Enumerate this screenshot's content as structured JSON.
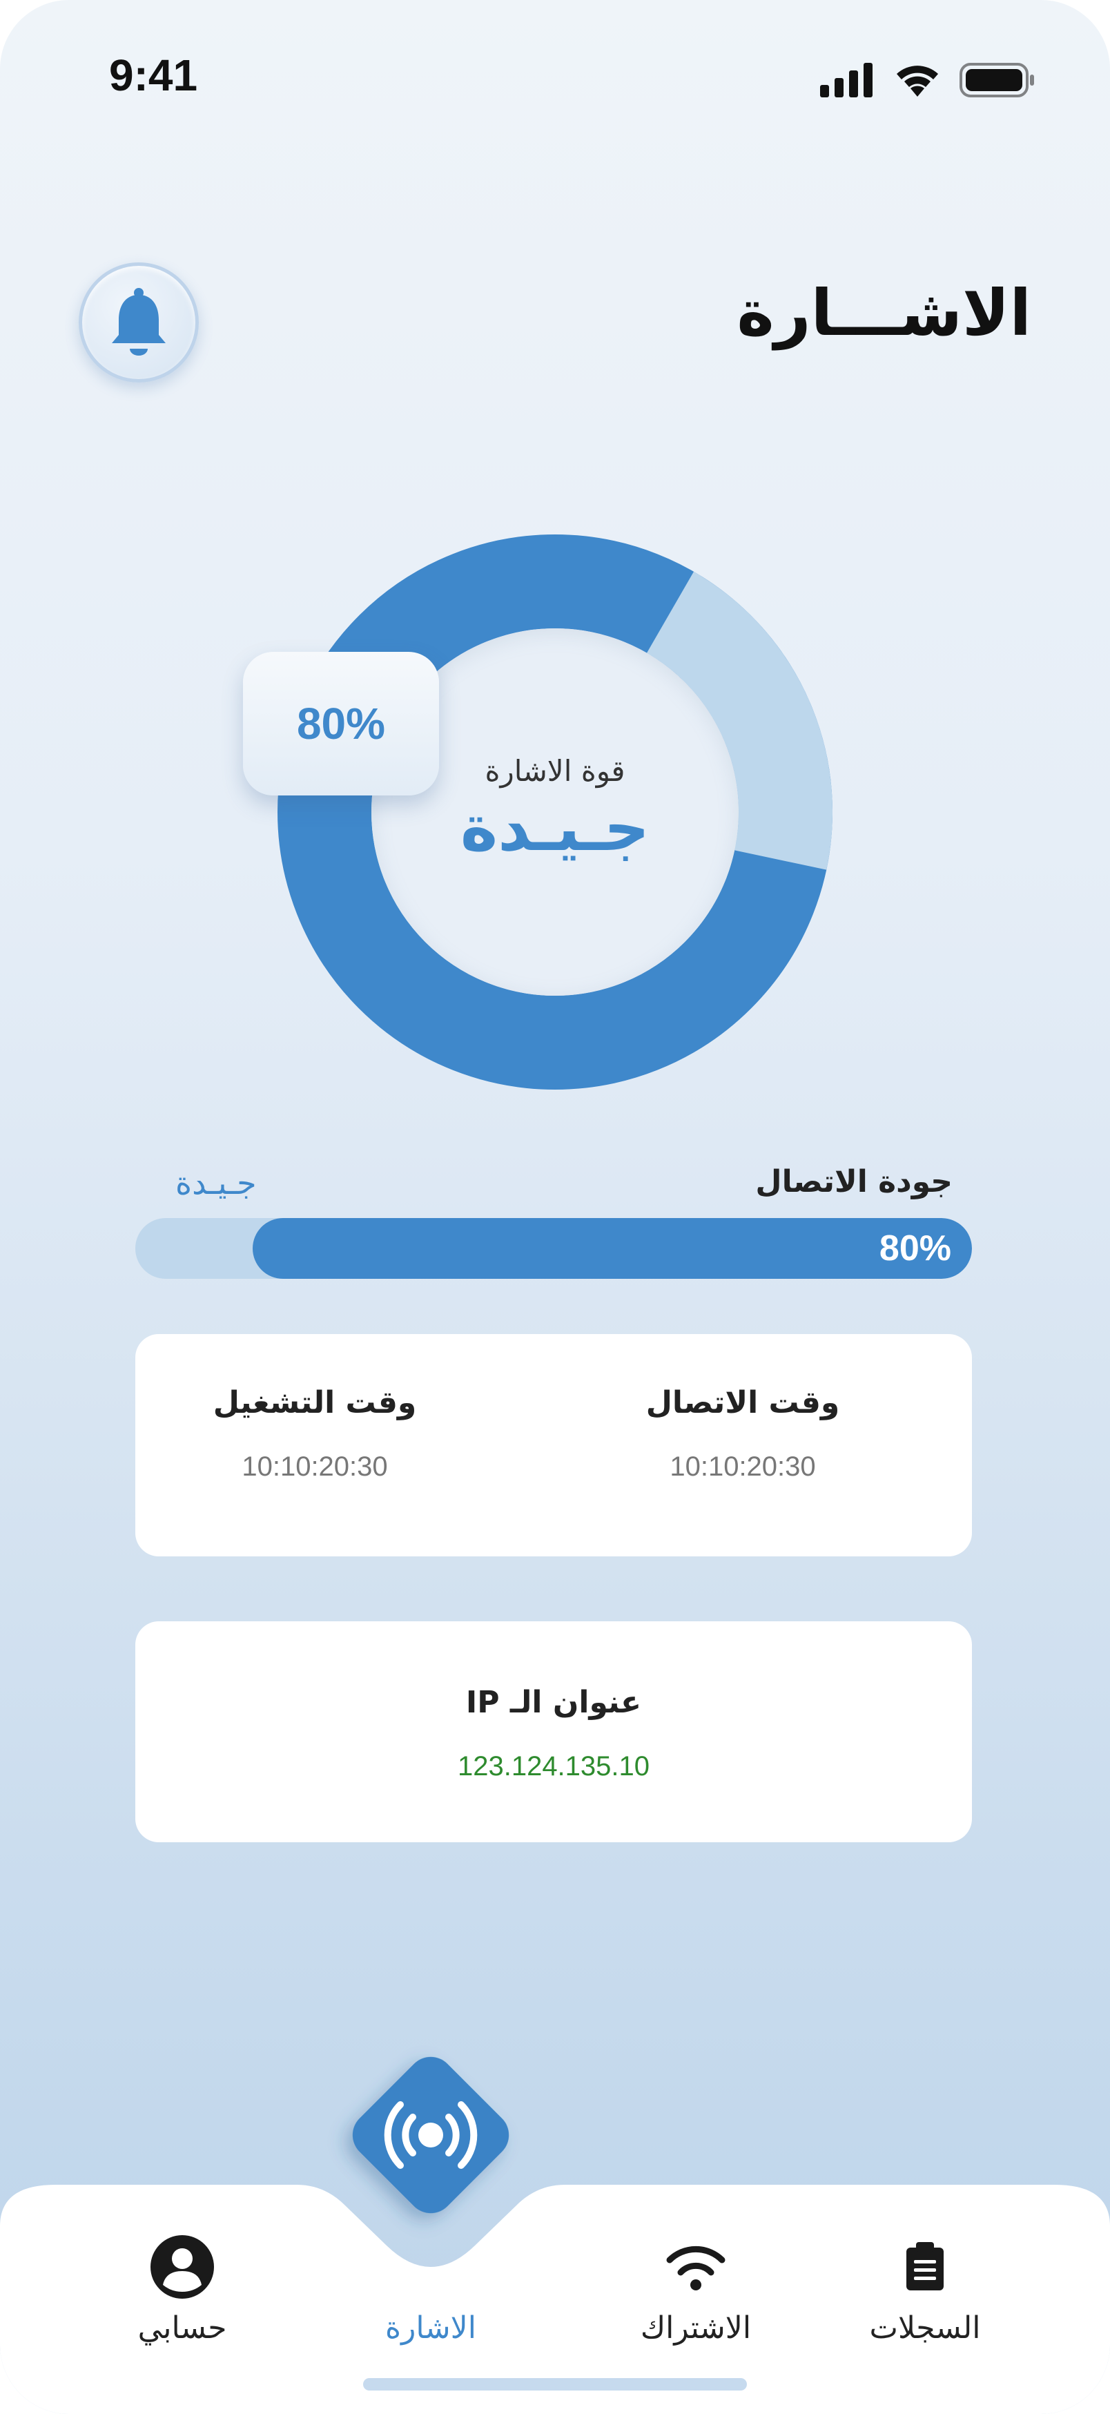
{
  "status_bar": {
    "time": "9:41"
  },
  "header": {
    "title": "الاشـــارة"
  },
  "signal": {
    "caption": "قوة الاشارة",
    "quality_word": "جـيـدة",
    "percent_label": "80%",
    "percent_value": 80,
    "colors": {
      "main": "#3f88cb",
      "light": "#bdd7ec"
    }
  },
  "connection_quality": {
    "label": "جودة الاتصال",
    "status": "جـيـدة",
    "percent_label": "80%",
    "percent_value": 86
  },
  "times_card": {
    "connection_time_label": "وقت الاتصال",
    "connection_time_value": "10:10:20:30",
    "run_time_label": "وقت التشغيل",
    "run_time_value": "10:10:20:30"
  },
  "ip_card": {
    "label": "عنوان الـ IP",
    "value": "123.124.135.10"
  },
  "nav": {
    "items": [
      {
        "label": "السجلات",
        "icon": "clipboard-icon"
      },
      {
        "label": "الاشتراك",
        "icon": "wifi-icon"
      },
      {
        "label": "الاشارة",
        "icon": "broadcast-icon",
        "active": true
      },
      {
        "label": "حسابي",
        "icon": "user-circle-icon"
      }
    ]
  }
}
